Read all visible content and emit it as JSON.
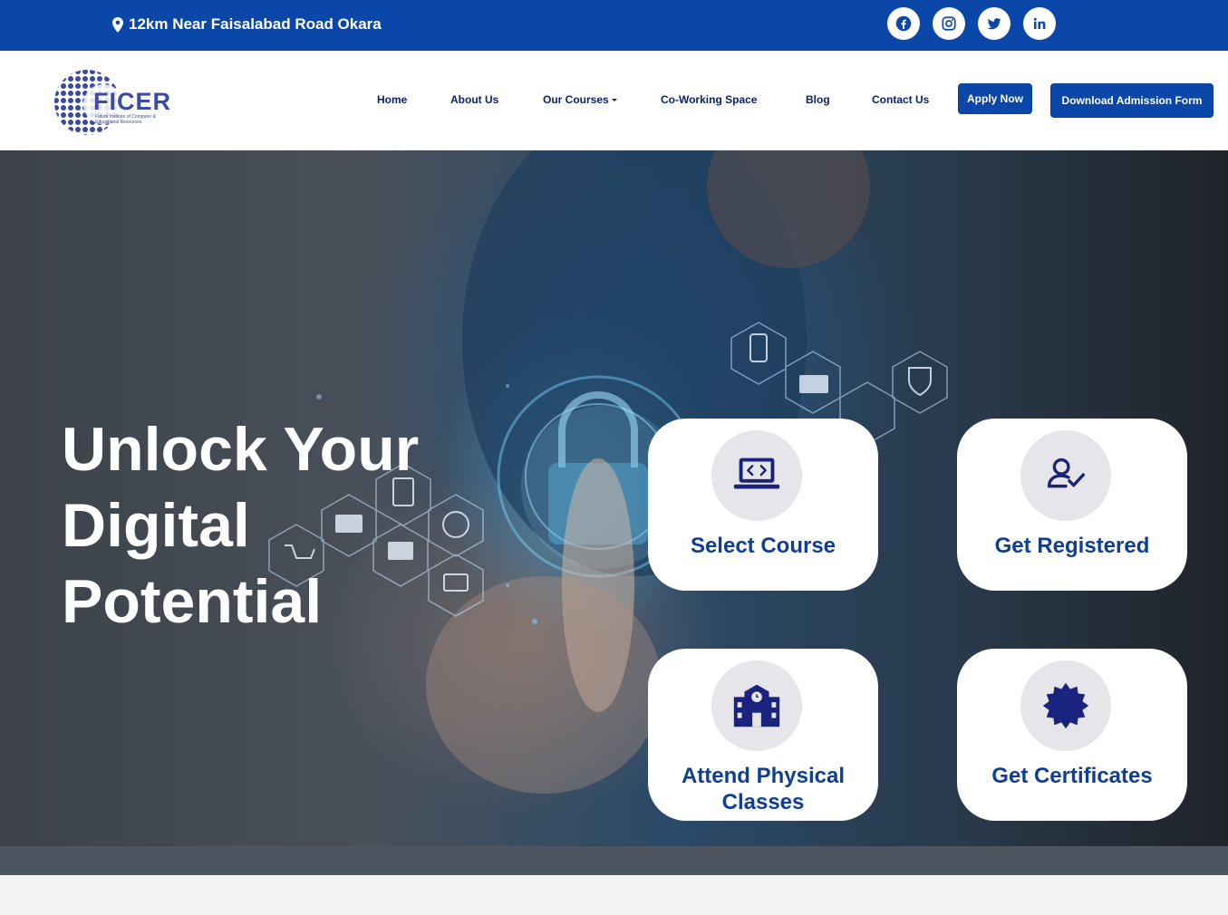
{
  "topbar": {
    "address": "12km Near Faisalabad Road Okara",
    "social_icons": [
      "facebook-icon",
      "instagram-icon",
      "twitter-icon",
      "linkedin-icon"
    ]
  },
  "navbar": {
    "logo_text": "FICER",
    "logo_tagline": "Future Institute of Computer & Educational Resources",
    "links": [
      "Home",
      "About Us",
      "Our Courses",
      "Co-Working Space",
      "Blog",
      "Contact Us"
    ],
    "apply_label": "Apply Now",
    "download_label": "Download Admission Form"
  },
  "hero": {
    "title_line1": "Unlock Your",
    "title_line2": "Digital",
    "title_line3": "Potential",
    "cards": [
      {
        "label": "Select Course",
        "icon": "laptop-code-icon"
      },
      {
        "label": "Get Registered",
        "icon": "user-check-icon"
      },
      {
        "label": "Attend Physical Classes",
        "icon": "school-icon"
      },
      {
        "label": "Get Certificates",
        "icon": "certificate-icon"
      }
    ]
  },
  "colors": {
    "brand_blue": "#0b47a8",
    "nav_text": "#10206b",
    "card_text": "#0e3f98",
    "icon_color": "#1a237e"
  }
}
